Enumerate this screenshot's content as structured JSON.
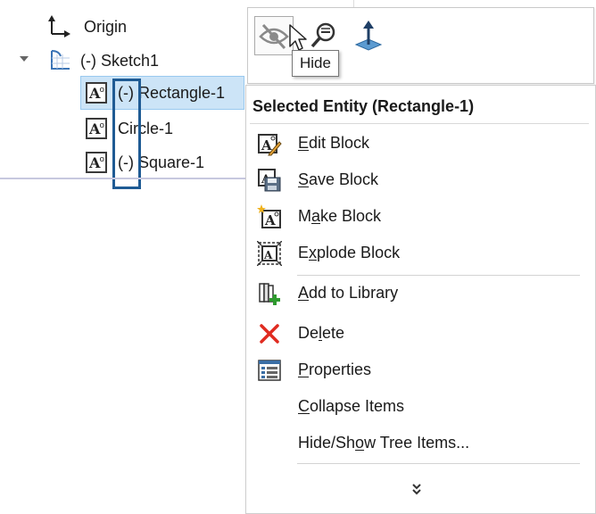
{
  "tree": {
    "origin_label": "Origin",
    "sketch_label": "(-) Sketch1",
    "items": [
      {
        "label": "(-) Rectangle-1",
        "selected": true
      },
      {
        "label": "Circle-1",
        "selected": false
      },
      {
        "label": "(-) Square-1",
        "selected": false
      }
    ],
    "block_icon_letter": "A"
  },
  "toolbar": {
    "buttons": [
      "hide-icon",
      "zoom-to-selection-icon",
      "normal-to-icon"
    ],
    "tooltip": "Hide"
  },
  "menu": {
    "title": "Selected Entity (Rectangle-1)",
    "items": [
      {
        "pre": "",
        "key": "E",
        "post": "dit Block",
        "icon": "edit-block-icon"
      },
      {
        "pre": "",
        "key": "S",
        "post": "ave Block",
        "icon": "save-block-icon"
      },
      {
        "pre": "M",
        "key": "a",
        "post": "ke Block",
        "icon": "make-block-icon"
      },
      {
        "pre": "E",
        "key": "x",
        "post": "plode Block",
        "icon": "explode-block-icon"
      },
      {
        "pre": "",
        "key": "A",
        "post": "dd to Library",
        "icon": "add-to-library-icon"
      },
      {
        "pre": "De",
        "key": "l",
        "post": "ete",
        "icon": "delete-icon"
      },
      {
        "pre": "",
        "key": "P",
        "post": "roperties",
        "icon": "properties-icon"
      },
      {
        "pre": "",
        "key": "C",
        "post": "ollapse Items",
        "icon": ""
      },
      {
        "pre": "Hide/Sh",
        "key": "o",
        "post": "w Tree Items...",
        "icon": ""
      }
    ],
    "more_icon": "double-chevron-down-icon"
  },
  "colors": {
    "selection_bg": "#cce4f7",
    "annotation_box": "#1f5b94",
    "delete_red": "#e02b20",
    "add_green": "#2e9a2e"
  }
}
